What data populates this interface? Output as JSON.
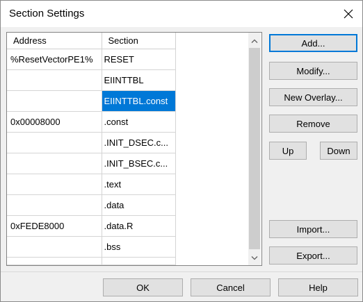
{
  "window": {
    "title": "Section Settings"
  },
  "table": {
    "columns": [
      "Address",
      "Section"
    ],
    "rows": [
      {
        "address": "%ResetVectorPE1%",
        "section": "RESET"
      },
      {
        "address": "",
        "section": "EIINTTBL"
      },
      {
        "address": "",
        "section": "EIINTTBL.const",
        "selected": true
      },
      {
        "address": "0x00008000",
        "section": ".const"
      },
      {
        "address": "",
        "section": ".INIT_DSEC.c..."
      },
      {
        "address": "",
        "section": ".INIT_BSEC.c..."
      },
      {
        "address": "",
        "section": ".text"
      },
      {
        "address": "",
        "section": ".data"
      },
      {
        "address": "0xFEDE8000",
        "section": ".data.R"
      },
      {
        "address": "",
        "section": ".bss"
      }
    ]
  },
  "buttons": {
    "add": "Add...",
    "modify": "Modify...",
    "new_overlay": "New Overlay...",
    "remove": "Remove",
    "up": "Up",
    "down": "Down",
    "import": "Import...",
    "export": "Export...",
    "ok": "OK",
    "cancel": "Cancel",
    "help": "Help"
  },
  "colors": {
    "selection": "#0078d7",
    "button_face": "#e1e1e1",
    "dialog_bg": "#f0f0f0"
  }
}
